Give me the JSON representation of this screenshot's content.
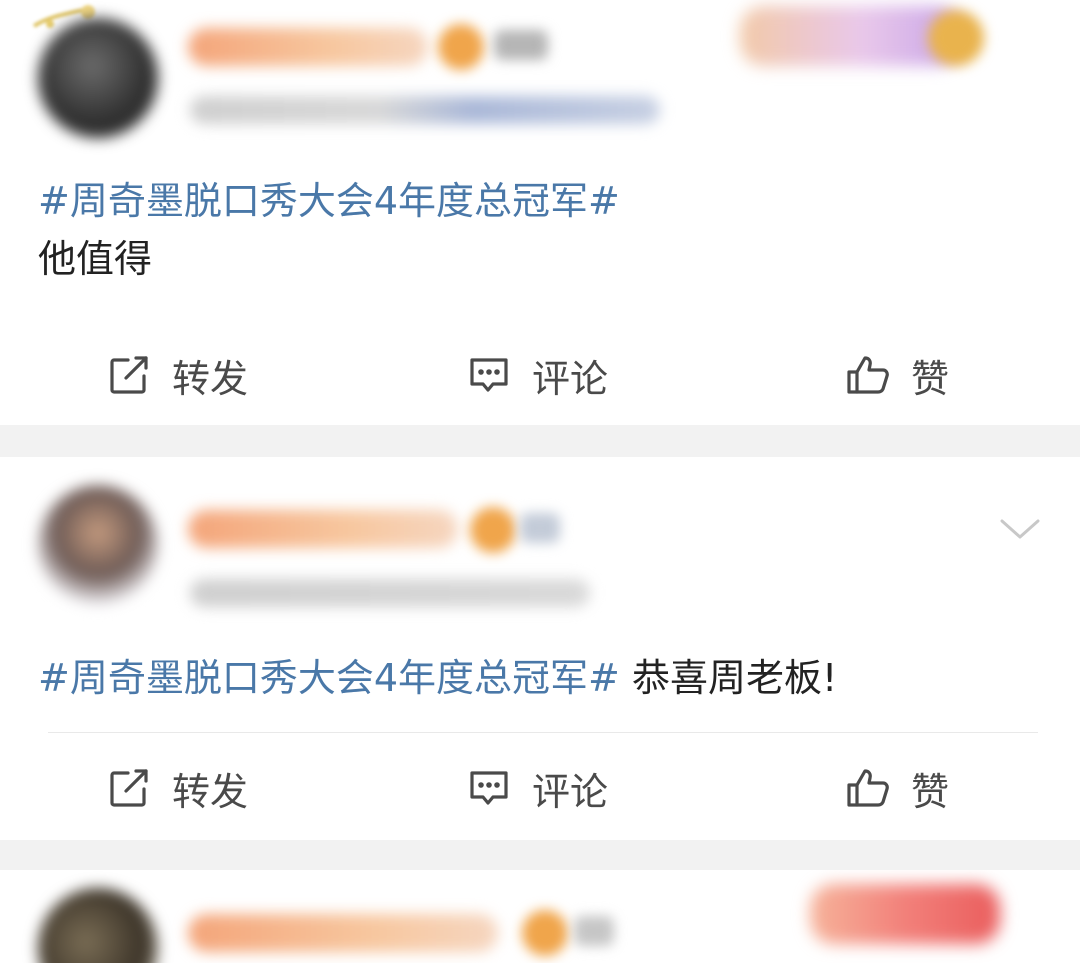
{
  "posts": [
    {
      "hashtag": "#周奇墨脱口秀大会4年度总冠军#",
      "body_line": "他值得",
      "actions": {
        "repost_label": "转发",
        "comment_label": "评论",
        "like_label": "赞"
      }
    },
    {
      "hashtag": "#周奇墨脱口秀大会4年度总冠军#",
      "body_line": " 恭喜周老板!",
      "actions": {
        "repost_label": "转发",
        "comment_label": "评论",
        "like_label": "赞"
      }
    }
  ],
  "icons": {
    "repost": "repost-icon",
    "comment": "comment-icon",
    "like": "thumbs-up-icon",
    "more": "chevron-down-icon"
  },
  "colors": {
    "hashtag": "#4a78a8",
    "text": "#222222",
    "action": "#4a4a4a",
    "feed_background": "#f2f2f2"
  }
}
